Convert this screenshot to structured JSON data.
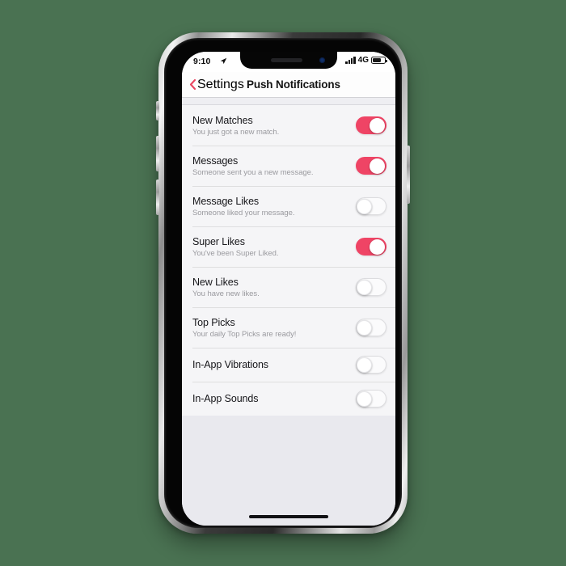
{
  "theme": {
    "page_background": "#4a7252",
    "accent": "#ef4465",
    "back_link_color": "#ea4560",
    "screen_background": "#e9e9ee",
    "row_background": "#f5f5f7",
    "separator": "#dededf",
    "toggle_off_background": "#fbfbfc",
    "title_color": "#16161a",
    "subtitle_color": "#9a9a9f"
  },
  "status_bar": {
    "time": "9:10",
    "location_icon": "location-arrow-icon",
    "signal_icon": "cellular-signal-icon",
    "signal_bars": 4,
    "network": "4G",
    "battery_icon": "battery-icon",
    "battery_percent": 60
  },
  "nav_bar": {
    "back_icon": "chevron-left-icon",
    "back_label": "Settings",
    "title": "Push Notifications"
  },
  "settings": {
    "rows": [
      {
        "title": "New Matches",
        "subtitle": "You just got a new match.",
        "toggle": "on",
        "name": "new-matches"
      },
      {
        "title": "Messages",
        "subtitle": "Someone sent you a new message.",
        "toggle": "on",
        "name": "messages"
      },
      {
        "title": "Message Likes",
        "subtitle": "Someone liked your message.",
        "toggle": "off",
        "name": "message-likes"
      },
      {
        "title": "Super Likes",
        "subtitle": "You've been Super Liked.",
        "toggle": "on",
        "name": "super-likes"
      },
      {
        "title": "New Likes",
        "subtitle": "You have new likes.",
        "toggle": "off",
        "name": "new-likes"
      },
      {
        "title": "Top Picks",
        "subtitle": "Your daily Top Picks are ready!",
        "toggle": "off",
        "name": "top-picks"
      },
      {
        "title": "In-App Vibrations",
        "subtitle": "",
        "toggle": "off",
        "name": "in-app-vibrations"
      },
      {
        "title": "In-App Sounds",
        "subtitle": "",
        "toggle": "off",
        "name": "in-app-sounds"
      }
    ]
  },
  "device": {
    "home_indicator": "home-indicator",
    "notch": "notch",
    "speaker": "earpiece-speaker",
    "camera": "front-camera",
    "buttons": [
      "silent-switch",
      "volume-up-button",
      "volume-down-button",
      "power-button"
    ]
  }
}
